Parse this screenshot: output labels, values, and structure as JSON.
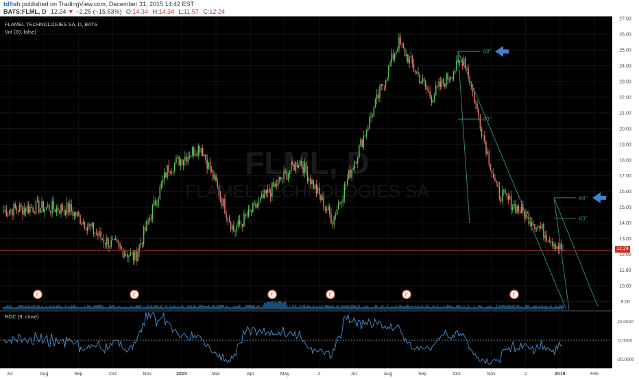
{
  "header": {
    "author": "tdfish",
    "published": "published on TradingView.com, December 31, 2015 14:42 EST",
    "symbol_line": "BATS:FLML, D",
    "last": "12.24",
    "change": "−2.25 (−15.53%)",
    "open_label": "O:",
    "open": "14.34",
    "high_label": "H:",
    "high": "14.34",
    "low_label": "L:",
    "low": "11.57",
    "close_label": "C:",
    "close": "12.24"
  },
  "legend": {
    "title": "FLAMEL TECHNOLOGIES SA, D, BATS",
    "volume": "Vol (20, false)",
    "roc": "ROC (9, close)"
  },
  "watermark": {
    "ticker": "FLML, D",
    "name": "FLAMEL TECHNOLOGIES SA"
  },
  "price_tag": "12.24",
  "annotations": [
    {
      "text": "-68°",
      "price": 24.9
    },
    {
      "text": "-83°",
      "price": 20.6
    },
    {
      "text": "-68°",
      "price": 15.6
    },
    {
      "text": "-83°",
      "price": 14.3
    }
  ],
  "earnings_marker": "E",
  "colors": {
    "background": "#000000",
    "up": "#59c659",
    "down": "#e57e6e",
    "volume": "#1f5f8b",
    "roc_line": "#4a87c0",
    "annotation": "#2f8a6d",
    "arrow": "#3f84c8",
    "price_line": "#d32f2f"
  },
  "chart_data": [
    {
      "type": "candlestick",
      "title": "FLAMEL TECHNOLOGIES SA, D, BATS",
      "ylim": [
        8.5,
        27.0
      ],
      "y_ticks": [
        "9.00",
        "10.00",
        "11.00",
        "12.00",
        "13.00",
        "14.00",
        "15.00",
        "16.00",
        "17.00",
        "18.00",
        "19.00",
        "20.00",
        "21.00",
        "22.00",
        "23.00",
        "24.00",
        "25.00",
        "26.00",
        "27.00"
      ],
      "x_ticks": [
        "Jul",
        "Aug",
        "Sep",
        "Oct",
        "Nov",
        "2015",
        "Mar",
        "Apr",
        "May",
        "2",
        "Jul",
        "Aug",
        "Sep",
        "Oct",
        "Nov",
        "2",
        "2016",
        "Feb"
      ],
      "series": [
        {
          "x": [
            "Jul 2014",
            "Aug 2014",
            "Sep 2014",
            "Oct 2014",
            "Nov 2014",
            "Dec 2014",
            "Jan 2015",
            "Feb 2015",
            "Mar 2015",
            "Apr 2015",
            "May 2015",
            "Jun 2015",
            "Jul 2015",
            "Aug 2015",
            "Sep 2015",
            "Oct 2015",
            "Nov 2015",
            "Dec 2015"
          ],
          "values": [
            14.8,
            15.0,
            14.9,
            13.0,
            11.8,
            17.5,
            18.9,
            13.5,
            15.8,
            18.0,
            14.2,
            19.8,
            25.5,
            22.0,
            24.5,
            16.0,
            14.3,
            12.24
          ]
        }
      ],
      "earnings_dates": [
        "Jul 2014",
        "Nov 2014",
        "Mar 2015",
        "May 2015",
        "Aug 2015",
        "Nov 2015"
      ]
    },
    {
      "type": "area",
      "title": "Vol (20, false)",
      "series": [
        {
          "x": [
            "Jan 2015"
          ],
          "values": [
            1
          ]
        }
      ]
    },
    {
      "type": "line",
      "title": "ROC (9, close)",
      "ylim": [
        -30,
        30
      ],
      "y_ticks": [
        "20.0000",
        "0.0000",
        "-20.0000"
      ]
    }
  ]
}
